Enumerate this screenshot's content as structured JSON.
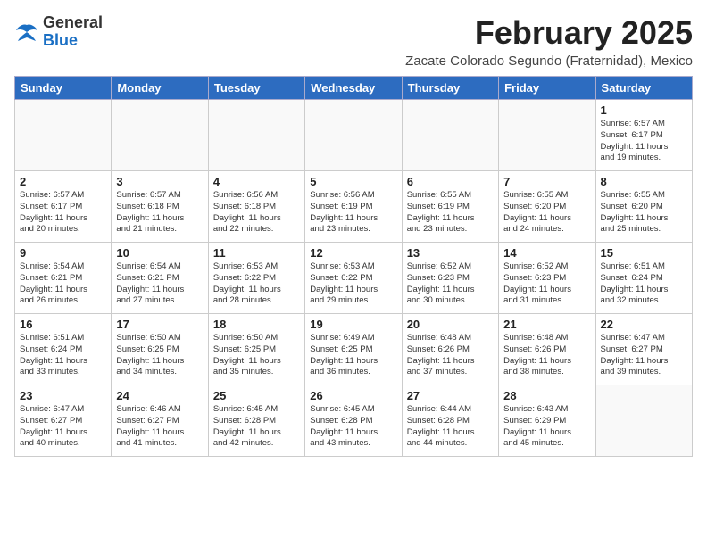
{
  "header": {
    "logo_general": "General",
    "logo_blue": "Blue",
    "month_title": "February 2025",
    "location": "Zacate Colorado Segundo (Fraternidad), Mexico"
  },
  "days_of_week": [
    "Sunday",
    "Monday",
    "Tuesday",
    "Wednesday",
    "Thursday",
    "Friday",
    "Saturday"
  ],
  "weeks": [
    [
      {
        "day": "",
        "info": ""
      },
      {
        "day": "",
        "info": ""
      },
      {
        "day": "",
        "info": ""
      },
      {
        "day": "",
        "info": ""
      },
      {
        "day": "",
        "info": ""
      },
      {
        "day": "",
        "info": ""
      },
      {
        "day": "1",
        "info": "Sunrise: 6:57 AM\nSunset: 6:17 PM\nDaylight: 11 hours\nand 19 minutes."
      }
    ],
    [
      {
        "day": "2",
        "info": "Sunrise: 6:57 AM\nSunset: 6:17 PM\nDaylight: 11 hours\nand 20 minutes."
      },
      {
        "day": "3",
        "info": "Sunrise: 6:57 AM\nSunset: 6:18 PM\nDaylight: 11 hours\nand 21 minutes."
      },
      {
        "day": "4",
        "info": "Sunrise: 6:56 AM\nSunset: 6:18 PM\nDaylight: 11 hours\nand 22 minutes."
      },
      {
        "day": "5",
        "info": "Sunrise: 6:56 AM\nSunset: 6:19 PM\nDaylight: 11 hours\nand 23 minutes."
      },
      {
        "day": "6",
        "info": "Sunrise: 6:55 AM\nSunset: 6:19 PM\nDaylight: 11 hours\nand 23 minutes."
      },
      {
        "day": "7",
        "info": "Sunrise: 6:55 AM\nSunset: 6:20 PM\nDaylight: 11 hours\nand 24 minutes."
      },
      {
        "day": "8",
        "info": "Sunrise: 6:55 AM\nSunset: 6:20 PM\nDaylight: 11 hours\nand 25 minutes."
      }
    ],
    [
      {
        "day": "9",
        "info": "Sunrise: 6:54 AM\nSunset: 6:21 PM\nDaylight: 11 hours\nand 26 minutes."
      },
      {
        "day": "10",
        "info": "Sunrise: 6:54 AM\nSunset: 6:21 PM\nDaylight: 11 hours\nand 27 minutes."
      },
      {
        "day": "11",
        "info": "Sunrise: 6:53 AM\nSunset: 6:22 PM\nDaylight: 11 hours\nand 28 minutes."
      },
      {
        "day": "12",
        "info": "Sunrise: 6:53 AM\nSunset: 6:22 PM\nDaylight: 11 hours\nand 29 minutes."
      },
      {
        "day": "13",
        "info": "Sunrise: 6:52 AM\nSunset: 6:23 PM\nDaylight: 11 hours\nand 30 minutes."
      },
      {
        "day": "14",
        "info": "Sunrise: 6:52 AM\nSunset: 6:23 PM\nDaylight: 11 hours\nand 31 minutes."
      },
      {
        "day": "15",
        "info": "Sunrise: 6:51 AM\nSunset: 6:24 PM\nDaylight: 11 hours\nand 32 minutes."
      }
    ],
    [
      {
        "day": "16",
        "info": "Sunrise: 6:51 AM\nSunset: 6:24 PM\nDaylight: 11 hours\nand 33 minutes."
      },
      {
        "day": "17",
        "info": "Sunrise: 6:50 AM\nSunset: 6:25 PM\nDaylight: 11 hours\nand 34 minutes."
      },
      {
        "day": "18",
        "info": "Sunrise: 6:50 AM\nSunset: 6:25 PM\nDaylight: 11 hours\nand 35 minutes."
      },
      {
        "day": "19",
        "info": "Sunrise: 6:49 AM\nSunset: 6:25 PM\nDaylight: 11 hours\nand 36 minutes."
      },
      {
        "day": "20",
        "info": "Sunrise: 6:48 AM\nSunset: 6:26 PM\nDaylight: 11 hours\nand 37 minutes."
      },
      {
        "day": "21",
        "info": "Sunrise: 6:48 AM\nSunset: 6:26 PM\nDaylight: 11 hours\nand 38 minutes."
      },
      {
        "day": "22",
        "info": "Sunrise: 6:47 AM\nSunset: 6:27 PM\nDaylight: 11 hours\nand 39 minutes."
      }
    ],
    [
      {
        "day": "23",
        "info": "Sunrise: 6:47 AM\nSunset: 6:27 PM\nDaylight: 11 hours\nand 40 minutes."
      },
      {
        "day": "24",
        "info": "Sunrise: 6:46 AM\nSunset: 6:27 PM\nDaylight: 11 hours\nand 41 minutes."
      },
      {
        "day": "25",
        "info": "Sunrise: 6:45 AM\nSunset: 6:28 PM\nDaylight: 11 hours\nand 42 minutes."
      },
      {
        "day": "26",
        "info": "Sunrise: 6:45 AM\nSunset: 6:28 PM\nDaylight: 11 hours\nand 43 minutes."
      },
      {
        "day": "27",
        "info": "Sunrise: 6:44 AM\nSunset: 6:28 PM\nDaylight: 11 hours\nand 44 minutes."
      },
      {
        "day": "28",
        "info": "Sunrise: 6:43 AM\nSunset: 6:29 PM\nDaylight: 11 hours\nand 45 minutes."
      },
      {
        "day": "",
        "info": ""
      }
    ]
  ]
}
